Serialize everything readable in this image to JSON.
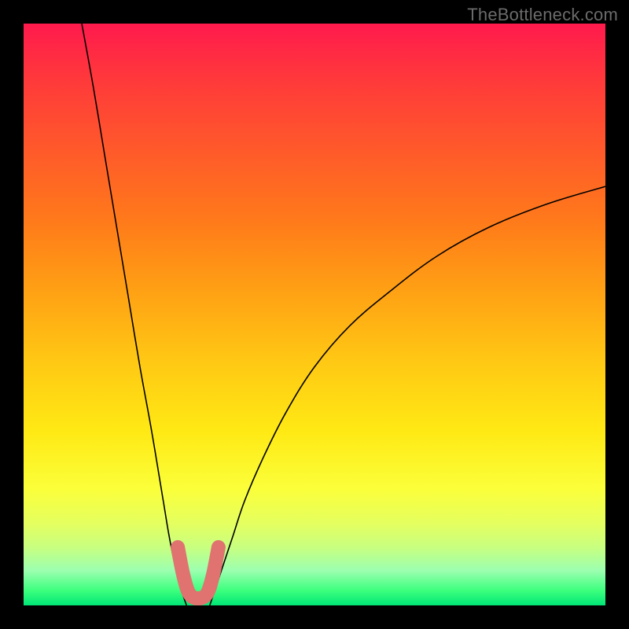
{
  "watermark": "TheBottleneck.com",
  "chart_data": {
    "type": "line",
    "title": "",
    "xlabel": "",
    "ylabel": "",
    "xlim": [
      0,
      100
    ],
    "ylim": [
      0,
      100
    ],
    "series": [
      {
        "name": "left-curve",
        "x": [
          10,
          12,
          14,
          16,
          18,
          20,
          22,
          24,
          25,
          26,
          27,
          28
        ],
        "values": [
          100,
          89,
          77,
          65,
          53,
          41,
          30,
          18,
          12,
          7,
          3,
          0
        ]
      },
      {
        "name": "right-curve",
        "x": [
          32,
          34,
          36,
          38,
          41,
          45,
          50,
          56,
          63,
          71,
          80,
          90,
          100
        ],
        "values": [
          0,
          6,
          12,
          18,
          25,
          33,
          41,
          48,
          54,
          60,
          65,
          69,
          72
        ]
      },
      {
        "name": "highlight-stub",
        "x": [
          26.5,
          27.5,
          28.5,
          30.0,
          31.5,
          32.5,
          33.5
        ],
        "values": [
          10.0,
          5.0,
          2.0,
          1.2,
          2.0,
          5.0,
          10.0
        ]
      }
    ]
  }
}
